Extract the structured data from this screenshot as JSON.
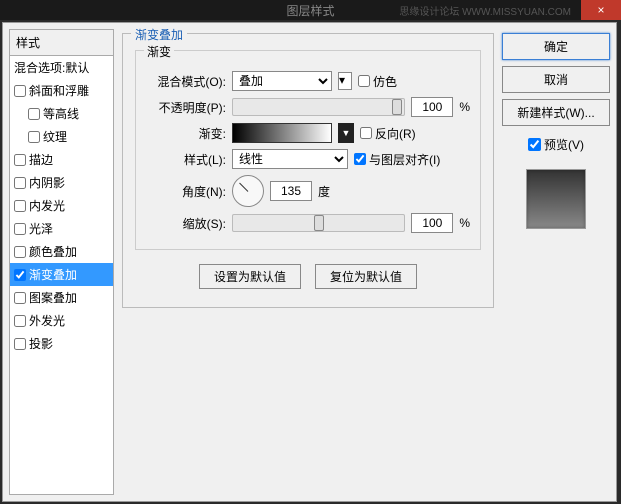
{
  "titlebar": {
    "title": "图层样式",
    "watermark": "思缘设计论坛 WWW.MISSYUAN.COM",
    "close": "×"
  },
  "left": {
    "header": "样式",
    "blending": "混合选项:默认",
    "items": [
      {
        "label": "斜面和浮雕",
        "indent": false,
        "checked": false
      },
      {
        "label": "等高线",
        "indent": true,
        "checked": false
      },
      {
        "label": "纹理",
        "indent": true,
        "checked": false
      },
      {
        "label": "描边",
        "indent": false,
        "checked": false
      },
      {
        "label": "内阴影",
        "indent": false,
        "checked": false
      },
      {
        "label": "内发光",
        "indent": false,
        "checked": false
      },
      {
        "label": "光泽",
        "indent": false,
        "checked": false
      },
      {
        "label": "颜色叠加",
        "indent": false,
        "checked": false
      },
      {
        "label": "渐变叠加",
        "indent": false,
        "checked": true,
        "selected": true
      },
      {
        "label": "图案叠加",
        "indent": false,
        "checked": false
      },
      {
        "label": "外发光",
        "indent": false,
        "checked": false
      },
      {
        "label": "投影",
        "indent": false,
        "checked": false
      }
    ]
  },
  "center": {
    "group_title": "渐变叠加",
    "sub_title": "渐变",
    "blend_mode_label": "混合模式(O):",
    "blend_mode_value": "叠加",
    "dither_label": "仿色",
    "opacity_label": "不透明度(P):",
    "opacity_value": "100",
    "pct": "%",
    "gradient_label": "渐变:",
    "reverse_label": "反向(R)",
    "style_label": "样式(L):",
    "style_value": "线性",
    "align_label": "与图层对齐(I)",
    "angle_label": "角度(N):",
    "angle_value": "135",
    "deg": "度",
    "scale_label": "缩放(S):",
    "scale_value": "100",
    "btn_default": "设置为默认值",
    "btn_reset": "复位为默认值"
  },
  "right": {
    "ok": "确定",
    "cancel": "取消",
    "new_style": "新建样式(W)...",
    "preview_label": "预览(V)"
  }
}
